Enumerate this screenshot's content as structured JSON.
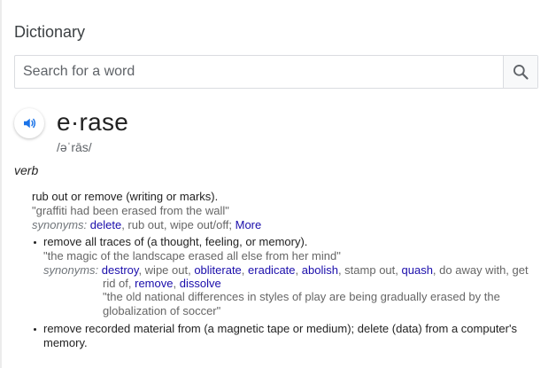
{
  "title": "Dictionary",
  "search": {
    "placeholder": "Search for a word"
  },
  "entry": {
    "word": "e·rase",
    "phonetic": "/əˈrās/",
    "part_of_speech": "verb"
  },
  "sense1": {
    "definition": "rub out or remove (writing or marks).",
    "example": "\"graffiti had been erased from the wall\"",
    "synonyms_label": "synonyms:",
    "syn_link_1": "delete",
    "syn_rest": ", rub out, wipe out/off;",
    "more": "More"
  },
  "sense2": {
    "definition": "remove all traces of (a thought, feeling, or memory).",
    "example": "\"the magic of the landscape erased all else from her mind\"",
    "synonyms_label": "synonyms:",
    "syn_1": "destroy",
    "sep_1": ", wipe out, ",
    "syn_2": "obliterate",
    "sep_2": ", ",
    "syn_3": "eradicate",
    "sep_3": ", ",
    "syn_4": "abolish",
    "sep_4": ", stamp out, ",
    "syn_5": "quash",
    "sep_5": ", do away with, get",
    "line2_start": "rid of, ",
    "syn_6": "remove",
    "sep_6": ", ",
    "syn_7": "dissolve",
    "example2_line1": "\"the old national differences in styles of play are being gradually erased by the",
    "example2_line2": "globalization of soccer\""
  },
  "sense3": {
    "definition_line1": "remove recorded material from (a magnetic tape or medium); delete (data) from a computer's",
    "definition_line2": "memory."
  }
}
